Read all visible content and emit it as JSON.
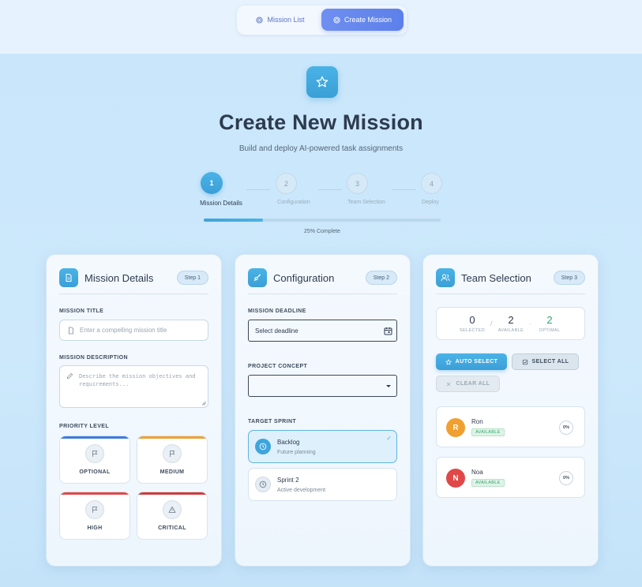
{
  "nav": {
    "tabs": [
      {
        "label": "Mission List",
        "icon": "target-icon"
      },
      {
        "label": "Create Mission",
        "icon": "target-icon",
        "active": true
      }
    ]
  },
  "header": {
    "icon": "star-icon",
    "title": "Create New Mission",
    "subtitle": "Build and deploy AI-powered task assignments"
  },
  "stepper": {
    "steps": [
      {
        "number": "1",
        "label": "Mission Details",
        "active": true
      },
      {
        "number": "2",
        "label": "Configuration"
      },
      {
        "number": "3",
        "label": "Team Selection"
      },
      {
        "number": "4",
        "label": "Deploy"
      }
    ],
    "progress_fraction": 0.25,
    "progress_text": "25% Complete"
  },
  "details": {
    "title": "Mission Details",
    "step_badge": "Step 1",
    "mission_title_label": "MISSION TITLE",
    "mission_title_placeholder": "Enter a compelling mission title",
    "mission_description_label": "MISSION DESCRIPTION",
    "mission_description_placeholder": "Describe the mission objectives and requirements...",
    "priority_label": "PRIORITY LEVEL",
    "priorities": [
      {
        "label": "OPTIONAL",
        "color": "#3d7be0",
        "icon": "flag-icon"
      },
      {
        "label": "MEDIUM",
        "color": "#f0a030",
        "icon": "flag-icon"
      },
      {
        "label": "HIGH",
        "color": "#e04848",
        "icon": "flag-icon"
      },
      {
        "label": "CRITICAL",
        "color": "#d03c3c",
        "icon": "warning-icon"
      }
    ]
  },
  "config": {
    "title": "Configuration",
    "step_badge": "Step 2",
    "deadline_label": "MISSION DEADLINE",
    "deadline_value": "Select deadline",
    "concept_label": "PROJECT CONCEPT",
    "concept_value": "",
    "sprint_label": "TARGET SPRINT",
    "sprints": [
      {
        "name": "Backlog",
        "desc": "Future planning",
        "selected": true,
        "check": "✓"
      },
      {
        "name": "Sprint 2",
        "desc": "Active development",
        "selected": false
      }
    ]
  },
  "team": {
    "title": "Team Selection",
    "step_badge": "Step 3",
    "stats": {
      "selected": "0",
      "selected_label": "SELECTED",
      "available": "2",
      "available_label": "AVAILABLE",
      "optimal": "2",
      "optimal_label": "OPTIMAL",
      "sep1": "/",
      "sep2": "·"
    },
    "auto_select": "AUTO SELECT",
    "select_all": "SELECT ALL",
    "clear_all": "CLEAR ALL",
    "members": [
      {
        "initial": "R",
        "name": "Ron",
        "status": "AVAILABLE",
        "pct": "0%",
        "color": "#f0a030"
      },
      {
        "initial": "N",
        "name": "Noa",
        "status": "AVAILABLE",
        "pct": "0%",
        "color": "#e04848"
      }
    ]
  },
  "colors": {
    "accent": "#3fa5dc",
    "brand_tab": "#5c80ea",
    "success": "#2fa869"
  }
}
